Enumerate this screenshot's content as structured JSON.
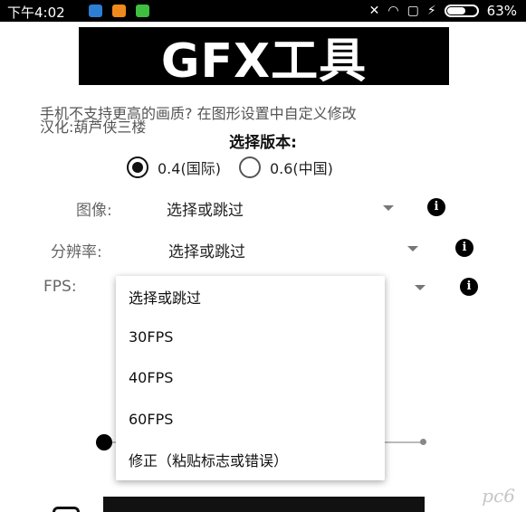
{
  "status_bar": {
    "time": "下午4:02",
    "battery": "63%",
    "battery_level": 0.63,
    "icons": [
      "mail-icon",
      "app-icon",
      "app-icon",
      "mute-icon",
      "wifi-icon",
      "sim-icon",
      "charging-icon",
      "battery-icon"
    ]
  },
  "header": {
    "title": "GFX工具"
  },
  "info": {
    "line1": "手机不支持更高的画质? 在图形设置中自定义修改",
    "line2": "汉化:葫芦侠三楼"
  },
  "version": {
    "heading": "选择版本:",
    "options": [
      {
        "label": "0.4(国际)",
        "selected": true
      },
      {
        "label": "0.6(中国)",
        "selected": false
      }
    ]
  },
  "settings": {
    "resolution_image": {
      "label": "图像:",
      "value": "选择或跳过"
    },
    "resolution_rate": {
      "label": "分辨率:",
      "value": "选择或跳过"
    },
    "fps": {
      "label": "FPS:"
    }
  },
  "dropdown": {
    "items": [
      "选择或跳过",
      "30FPS",
      "40FPS",
      "60FPS",
      "修正（粘贴标志或错误）"
    ]
  },
  "colors": {
    "black": "#000000",
    "background": "#ffffff"
  },
  "watermark": "pc6"
}
